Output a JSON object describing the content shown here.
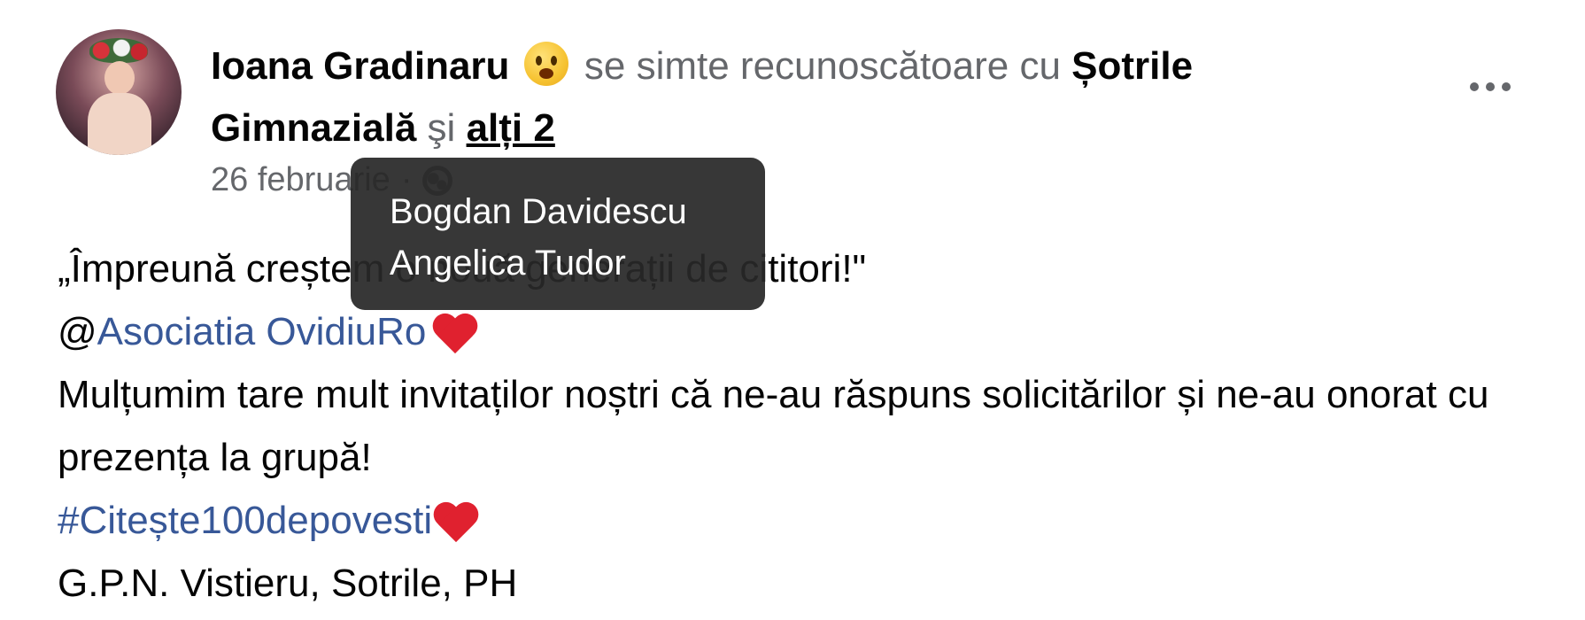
{
  "post": {
    "author": "Ioana Gradinaru",
    "feeling": "se simte recunoscătoare cu",
    "tagged_page": "Șotrile Gimnazială",
    "conjunction": "şi",
    "others_link": "alți 2",
    "date": "26 februarie",
    "separator": "·",
    "body": {
      "line1": "„Împreună creștem o nouă generații de cititori!\"",
      "mention_prefix": "@",
      "mention": "Asociatia OvidiuRo",
      "line3": "Mulțumim tare mult invitaților noștri că  ne-au răspuns solicitărilor și ne-au onorat cu prezența  la grupă!",
      "hashtag": "#Citește100depovesti",
      "location": "G.P.N. Vistieru, Sotrile, PH"
    }
  },
  "tooltip": {
    "names": [
      "Bogdan Davidescu",
      "Angelica Tudor"
    ]
  },
  "icons": {
    "emoji": "happy-face-icon",
    "privacy": "globe-icon",
    "heart": "red-heart-icon",
    "menu": "more-options-icon"
  },
  "colors": {
    "link_blue": "#385898",
    "secondary_text": "#65676b",
    "heart_red": "#e0212f",
    "tooltip_bg": "#282828"
  }
}
